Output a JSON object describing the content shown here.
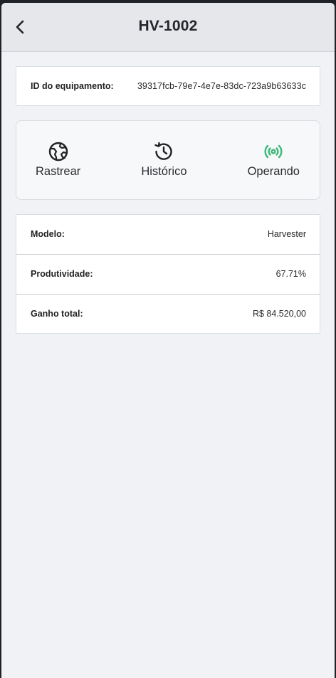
{
  "header": {
    "title": "HV-1002",
    "back_icon": "chevron-left-icon"
  },
  "equipment_id": {
    "label": "ID do equipamento:",
    "value": "39317fcb-79e7-4e7e-83dc-723a9b63633c"
  },
  "actions": [
    {
      "label": "Rastrear",
      "icon": "globe-icon",
      "color": "#222222"
    },
    {
      "label": "Histórico",
      "icon": "history-icon",
      "color": "#222222"
    },
    {
      "label": "Operando",
      "icon": "broadcast-icon",
      "color": "#3cb878"
    }
  ],
  "details": [
    {
      "label": "Modelo:",
      "value": "Harvester"
    },
    {
      "label": "Produtividade:",
      "value": "67.71%"
    },
    {
      "label": "Ganho total:",
      "value": "R$ 84.520,00"
    }
  ]
}
